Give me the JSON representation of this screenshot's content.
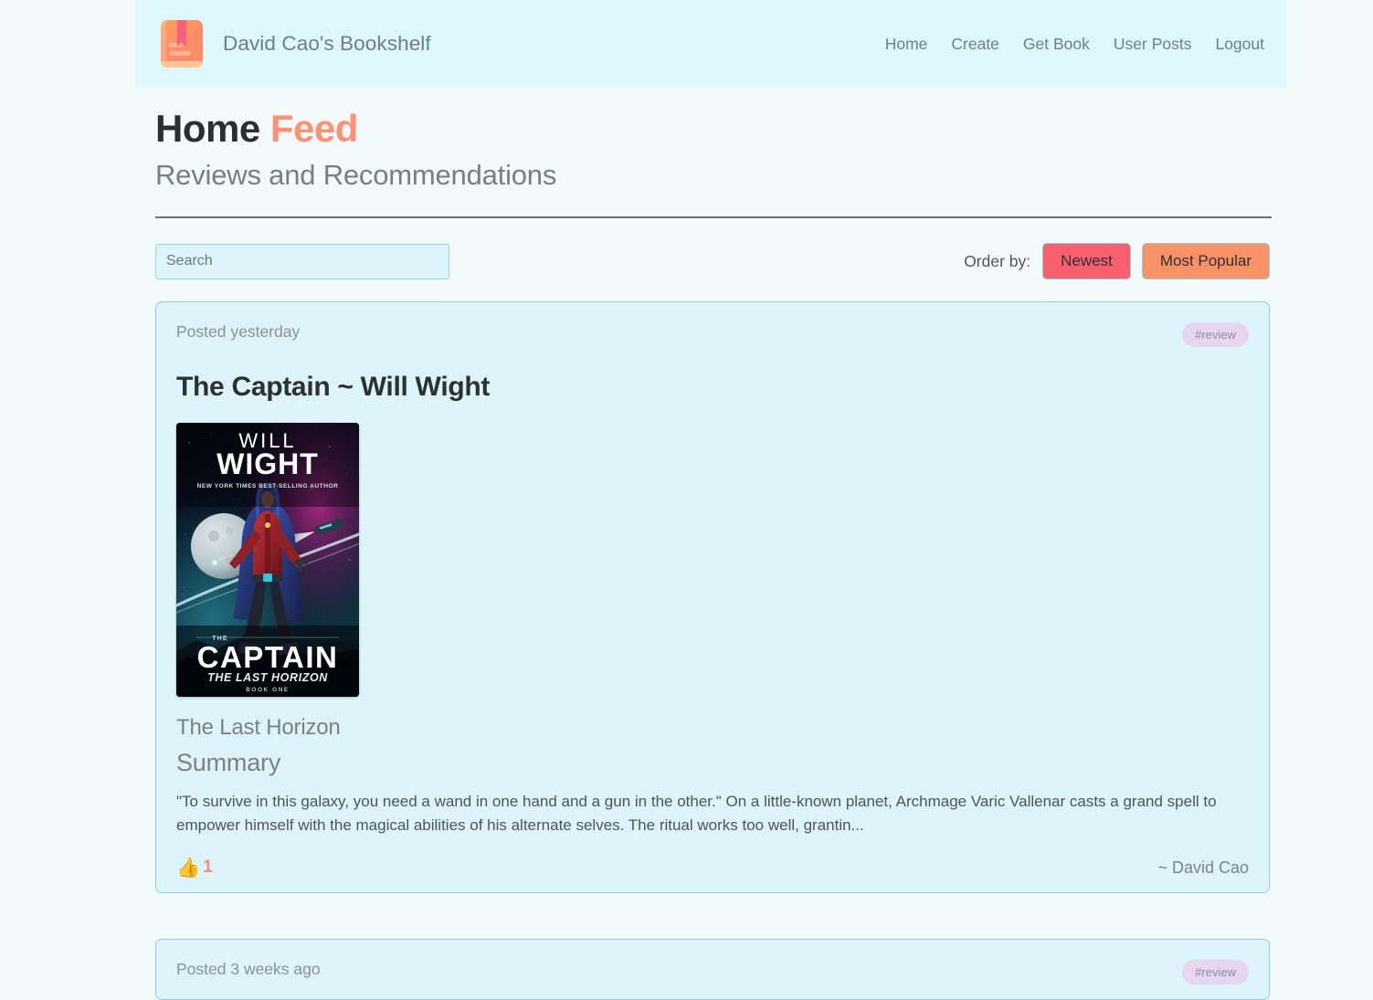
{
  "theme": {
    "page_bg": "#f2fafc",
    "header_bg": "#ddf7fb",
    "card_bg": "#ddf5fa",
    "card_border": "#8ad0e2",
    "accent_coral": "#fd9173",
    "accent_red": "#f8606e",
    "accent_orange": "#fa9268",
    "tag_bg": "#e7d6ef",
    "text_dark": "#2c3133",
    "text_muted": "#7d8487"
  },
  "header": {
    "logo_icon": "book-icon",
    "brand": "David Cao's Bookshelf",
    "nav": [
      {
        "label": "Home"
      },
      {
        "label": "Create"
      },
      {
        "label": "Get Book"
      },
      {
        "label": "User Posts"
      },
      {
        "label": "Logout"
      }
    ]
  },
  "page": {
    "title_main": "Home",
    "title_accent": "Feed",
    "subtitle": "Reviews and Recommendations"
  },
  "controls": {
    "search_value": "",
    "search_placeholder": "Search",
    "order_label": "Order by:",
    "order_newest": "Newest",
    "order_popular": "Most Popular"
  },
  "posts": [
    {
      "posted_on": "Posted yesterday",
      "tag": "#review",
      "title": "The Captain ~ Will Wight",
      "cover": {
        "author_line1": "WILL",
        "author_line2": "WIGHT",
        "author_tagline": "NEW YORK TIMES BEST-SELLING AUTHOR",
        "title_big": "CAPTAIN",
        "the_small": "THE",
        "subtitle": "THE LAST HORIZON",
        "book_number": "BOOK ONE"
      },
      "book_name": "The Last Horizon",
      "summary_heading": "Summary",
      "summary": "\"To survive in this galaxy, you need a wand in one hand and a gun in the other.\" On a little-known planet, Archmage Varic Vallenar casts a grand spell to empower himself with the magical abilities of his alternate selves. The ritual works too well, grantin...",
      "like_icon": "thumbs-up-icon",
      "like_count": "1",
      "author_sign": "~ David Cao"
    },
    {
      "posted_on": "Posted 3 weeks ago",
      "tag": "#review"
    }
  ]
}
